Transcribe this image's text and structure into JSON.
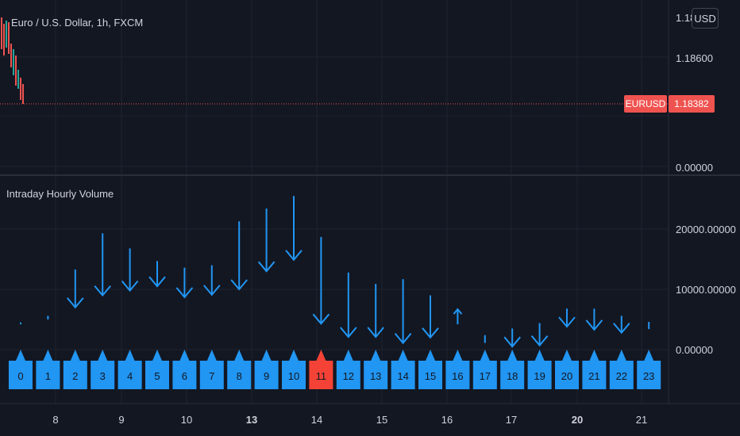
{
  "header": {
    "symbol_title": "Euro / U.S. Dollar, 1h, FXCM",
    "currency_button": "USD"
  },
  "price_pane": {
    "axis_ticks": [
      "1.18",
      "1.18600",
      "0.00000"
    ],
    "last_price": {
      "symbol": "EURUSD",
      "value": "1.18382"
    },
    "colors": {
      "down": "#ef5350",
      "up": "#26a69a",
      "price_line": "#ef5350"
    }
  },
  "chart_data": {
    "type": "bar",
    "title": "Intraday Hourly Volume",
    "x_axis_ticks": [
      "8",
      "9",
      "10",
      "13",
      "14",
      "15",
      "16",
      "17",
      "20",
      "21"
    ],
    "bold_x_ticks": [
      "13",
      "20"
    ],
    "y_axis_ticks": [
      "0.00000",
      "10000.00000",
      "20000.00000"
    ],
    "ylim": [
      -5500,
      27000
    ],
    "hours": [
      "0",
      "1",
      "2",
      "3",
      "4",
      "5",
      "6",
      "7",
      "8",
      "9",
      "10",
      "11",
      "12",
      "13",
      "14",
      "15",
      "16",
      "17",
      "18",
      "19",
      "20",
      "21",
      "22",
      "23"
    ],
    "highlighted_hour": "11",
    "colors": {
      "volume": "#2196f3",
      "highlight": "#f44336"
    },
    "volume_marks": [
      {
        "dir": "down",
        "top": 4500,
        "bottom": 4200
      },
      {
        "dir": "down",
        "top": 5600,
        "bottom": 5000
      },
      {
        "dir": "down",
        "top": 13300,
        "bottom": 7000
      },
      {
        "dir": "down",
        "top": 19300,
        "bottom": 9000
      },
      {
        "dir": "down",
        "top": 16800,
        "bottom": 9800
      },
      {
        "dir": "down",
        "top": 14700,
        "bottom": 10500
      },
      {
        "dir": "down",
        "top": 13600,
        "bottom": 8700
      },
      {
        "dir": "down",
        "top": 14000,
        "bottom": 9100
      },
      {
        "dir": "down",
        "top": 21300,
        "bottom": 10000
      },
      {
        "dir": "down",
        "top": 23400,
        "bottom": 13000
      },
      {
        "dir": "down",
        "top": 25500,
        "bottom": 14900
      },
      {
        "dir": "down",
        "top": 18700,
        "bottom": 4300
      },
      {
        "dir": "down",
        "top": 12800,
        "bottom": 2100
      },
      {
        "dir": "down",
        "top": 10900,
        "bottom": 2100
      },
      {
        "dir": "down",
        "top": 11700,
        "bottom": 1100
      },
      {
        "dir": "down",
        "top": 9000,
        "bottom": 2000
      },
      {
        "dir": "up",
        "top": 6700,
        "bottom": 4200
      },
      {
        "dir": "down",
        "top": 2400,
        "bottom": 1100
      },
      {
        "dir": "down",
        "top": 3500,
        "bottom": 500
      },
      {
        "dir": "down",
        "top": 4400,
        "bottom": 700
      },
      {
        "dir": "down",
        "top": 6800,
        "bottom": 3800
      },
      {
        "dir": "down",
        "top": 6800,
        "bottom": 3300
      },
      {
        "dir": "down",
        "top": 5600,
        "bottom": 2800
      },
      {
        "dir": "down",
        "top": 4600,
        "bottom": 3400
      }
    ]
  }
}
